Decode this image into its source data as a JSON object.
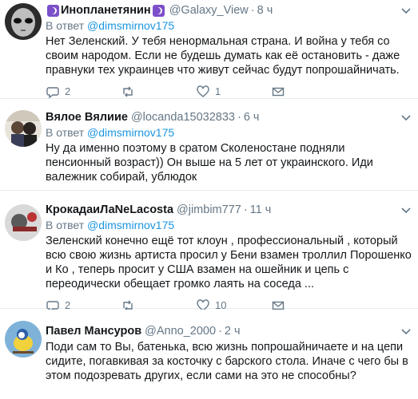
{
  "tweets": [
    {
      "name": "Инопланетянин",
      "handle": "@Galaxy_View",
      "time": "8 ч",
      "reply_prefix": "В ответ",
      "reply_to": "@dimsmirnov175",
      "text": "Нет Зеленский. У тебя ненормальная страна. И война у тебя со своим народом. Если не будешь думать как её остановить - даже правнуки тех украинцев что живут сейчас будут попрошайничать.",
      "replies": "2",
      "retweets": "",
      "likes": "1"
    },
    {
      "name": "Вялое Вялиие",
      "handle": "@locanda15032833",
      "time": "6 ч",
      "reply_prefix": "В ответ",
      "reply_to": "@dimsmirnov175",
      "text": "Ну да именно поэтому в сратом Сколеностане подняли пенсионный возраст)) Он выше на 5 лет от украинского. Иди валежник собирай, ублюдок"
    },
    {
      "name": "КрокадаиЛаNeLacosta",
      "handle": "@jimbim777",
      "time": "11 ч",
      "reply_prefix": "В ответ",
      "reply_to": "@dimsmirnov175",
      "text": "Зеленский конечно ещё тот клоун , профессиональный , который всю свою жизнь артиста просил у Бени  взамен троллил Порошенко и Ко , теперь просит у США взамен на ошейник и цепь с переодически обещает громко лаять на соседа ...",
      "replies": "2",
      "retweets": "",
      "likes": "10"
    },
    {
      "name": "Павел Мансуров",
      "handle": "@Anno_2000",
      "time": "2 ч",
      "reply_prefix": "В ответ",
      "reply_to": "",
      "text": "Поди сам то Вы, батенька, всю жизнь попрошайничаете и на цепи сидите, погавкивая за косточку с барского стола. Иначе с чего бы в этом подозревать других, если сами на это не способны?"
    }
  ],
  "colors": {
    "text": "#14171a",
    "muted": "#657786",
    "link": "#1b95e0",
    "border": "#e6ecf0",
    "badge": "#7b4fc9"
  },
  "icons": [
    "reply-icon",
    "retweet-icon",
    "like-icon",
    "envelope-icon",
    "chevron-down-icon",
    "crescent-badge-icon"
  ]
}
